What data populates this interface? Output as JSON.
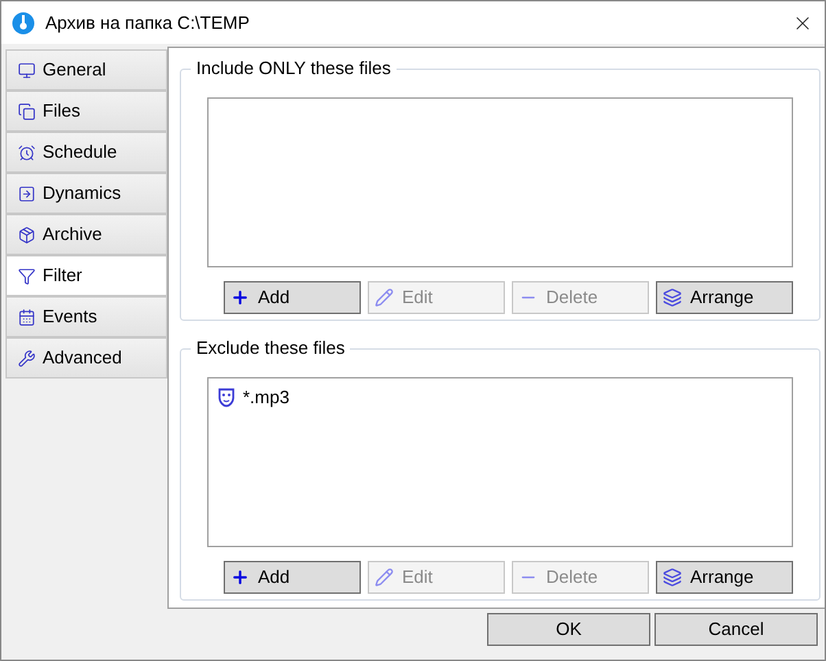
{
  "window": {
    "title": "Архив на папка C:\\TEMP"
  },
  "tabs": [
    {
      "label": "General",
      "selected": false
    },
    {
      "label": "Files",
      "selected": false
    },
    {
      "label": "Schedule",
      "selected": false
    },
    {
      "label": "Dynamics",
      "selected": false
    },
    {
      "label": "Archive",
      "selected": false
    },
    {
      "label": "Filter",
      "selected": true
    },
    {
      "label": "Events",
      "selected": false
    },
    {
      "label": "Advanced",
      "selected": false
    }
  ],
  "groups": [
    {
      "title": "Include ONLY these files",
      "buttons": [
        {
          "label": "Add",
          "disabled": false
        },
        {
          "label": "Edit",
          "disabled": true
        },
        {
          "label": "Delete",
          "disabled": true
        },
        {
          "label": "Arrange",
          "disabled": false
        }
      ]
    },
    {
      "title": "Exclude these files",
      "items": [
        "*.mp3"
      ],
      "buttons": [
        {
          "label": "Add",
          "disabled": false
        },
        {
          "label": "Edit",
          "disabled": true
        },
        {
          "label": "Delete",
          "disabled": true
        },
        {
          "label": "Arrange",
          "disabled": false
        }
      ]
    }
  ],
  "footer": [
    "OK",
    "Cancel"
  ]
}
